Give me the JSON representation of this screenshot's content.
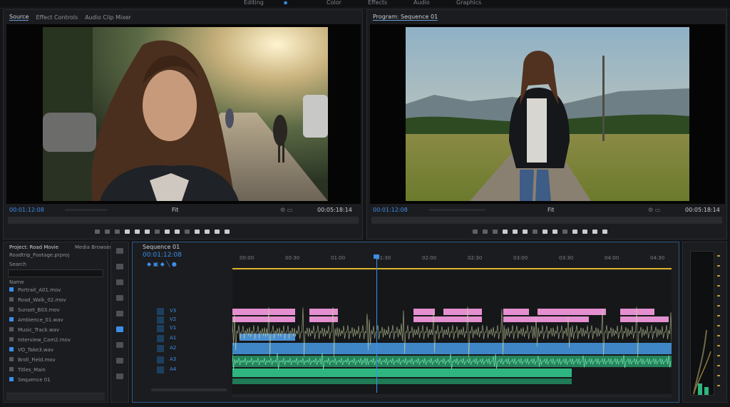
{
  "topbar": {
    "items": [
      "Editing",
      "Color",
      "Effects",
      "Audio",
      "Graphics"
    ]
  },
  "source_monitor": {
    "tabs": [
      "Source",
      "Effect Controls",
      "Audio Clip Mixer"
    ],
    "timecode_in": "00:01:12:08",
    "scale_label": "Fit",
    "timecode_out": "00:05:18:14"
  },
  "program_monitor": {
    "title": "Program: Sequence 01",
    "timecode_in": "00:01:12:08",
    "scale_label": "Fit",
    "timecode_out": "00:05:18:14"
  },
  "project": {
    "title": "Project: Road Movie",
    "subtitle": "Media Browser",
    "bin": "Roadtrip_Footage.prproj",
    "search_label": "Search",
    "column_header": "Name",
    "items": [
      "Portrait_A01.mov",
      "Road_Walk_02.mov",
      "Sunset_B03.mov",
      "Ambience_01.wav",
      "Music_Track.wav",
      "Interview_Cam2.mov",
      "VO_Take3.wav",
      "Broll_Field.mov",
      "Titles_Main",
      "Sequence 01"
    ]
  },
  "timeline": {
    "title": "Sequence 01",
    "timecode": "00:01:12:08",
    "ruler": [
      "00:00",
      "00:30",
      "01:00",
      "01:30",
      "02:00",
      "02:30",
      "03:00",
      "03:30",
      "04:00",
      "04:30"
    ],
    "track_labels": [
      "V3",
      "V2",
      "V1",
      "A1",
      "A2",
      "A3",
      "A4"
    ]
  },
  "colors": {
    "accent": "#3d8ee8",
    "video_clip": "#e48fd0",
    "audio_blue": "#3f86c7",
    "audio_green": "#2fb680",
    "playhead": "#3c8ee6"
  }
}
